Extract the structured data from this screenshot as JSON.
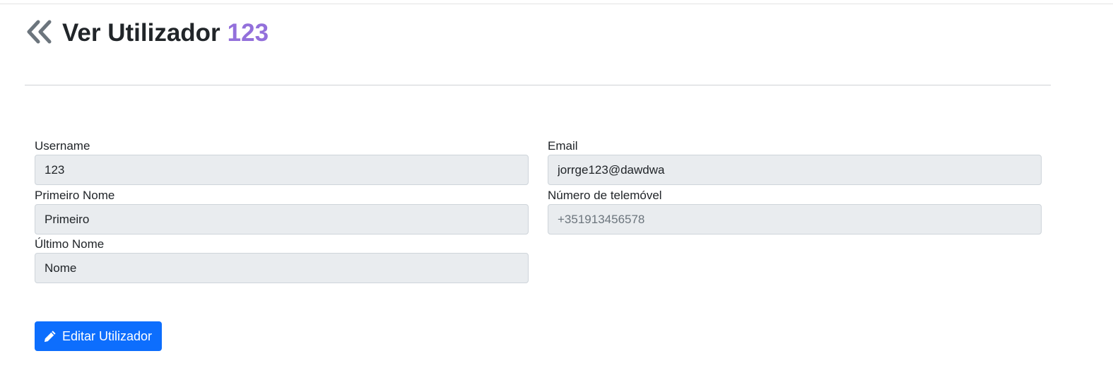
{
  "header": {
    "title": "Ver Utilizador",
    "user_id": "123"
  },
  "form": {
    "username": {
      "label": "Username",
      "value": "123"
    },
    "email": {
      "label": "Email",
      "value": "jorrge123@dawdwa"
    },
    "first_name": {
      "label": "Primeiro Nome",
      "value": "Primeiro"
    },
    "phone": {
      "label": "Número de telemóvel",
      "placeholder": "+351913456578"
    },
    "last_name": {
      "label": "Último Nome",
      "value": "Nome"
    }
  },
  "actions": {
    "edit_label": "Editar Utilizador"
  },
  "colors": {
    "accent": "#9370db",
    "primary_button": "#0d6efd",
    "readonly_input_bg": "#e9ecef"
  },
  "icons": {
    "back": "double-chevron-left-icon",
    "edit": "pencil-icon"
  }
}
